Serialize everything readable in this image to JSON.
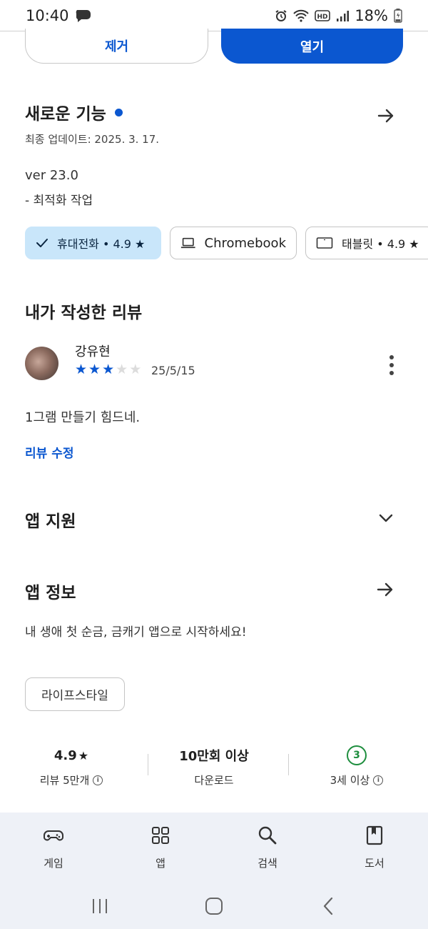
{
  "status_bar": {
    "time": "10:40",
    "battery": "18%",
    "icons": [
      "chat-icon",
      "alarm-icon",
      "wifi-icon",
      "hd-icon",
      "signal-icon",
      "battery-icon"
    ]
  },
  "actions": {
    "remove_label": "제거",
    "open_label": "열기"
  },
  "whats_new": {
    "title": "새로운 기능",
    "updated": "최종 업데이트: 2025. 3. 17.",
    "version": "ver 23.0",
    "note": "- 최적화 작업"
  },
  "device_chips": [
    {
      "label": "휴대전화 • 4.9 ★",
      "icon": "check-icon",
      "selected": true
    },
    {
      "label": "Chromebook",
      "icon": "laptop-icon",
      "selected": false
    },
    {
      "label": "태블릿 • 4.9 ★",
      "icon": "tablet-icon",
      "selected": false
    }
  ],
  "my_review": {
    "title": "내가 작성한 리뷰",
    "reviewer_name": "강유현",
    "rating": 3,
    "max_rating": 5,
    "date": "25/5/15",
    "text": "1그램 만들기  힘드네.",
    "edit_label": "리뷰 수정"
  },
  "app_support": {
    "title": "앱 지원"
  },
  "about": {
    "title": "앱 정보",
    "description": "내 생애 첫 순금, 금캐기 앱으로 시작하세요!",
    "category": "라이프스타일"
  },
  "stats": {
    "rating_value": "4.9",
    "rating_star": "★",
    "rating_label": "리뷰 5만개",
    "downloads_value": "10만회 이상",
    "downloads_label": "다운로드",
    "age_value": "3",
    "age_label": "3세 이상",
    "info_glyph": "i"
  },
  "bottom_nav": [
    {
      "label": "게임",
      "icon": "gamepad-icon"
    },
    {
      "label": "앱",
      "icon": "apps-grid-icon"
    },
    {
      "label": "검색",
      "icon": "search-icon"
    },
    {
      "label": "도서",
      "icon": "book-icon"
    }
  ],
  "colors": {
    "accent": "#0b57d0",
    "chip_selected": "#c9e6fa",
    "age_green": "#1e8e3e",
    "nav_background": "#eef1f7"
  }
}
